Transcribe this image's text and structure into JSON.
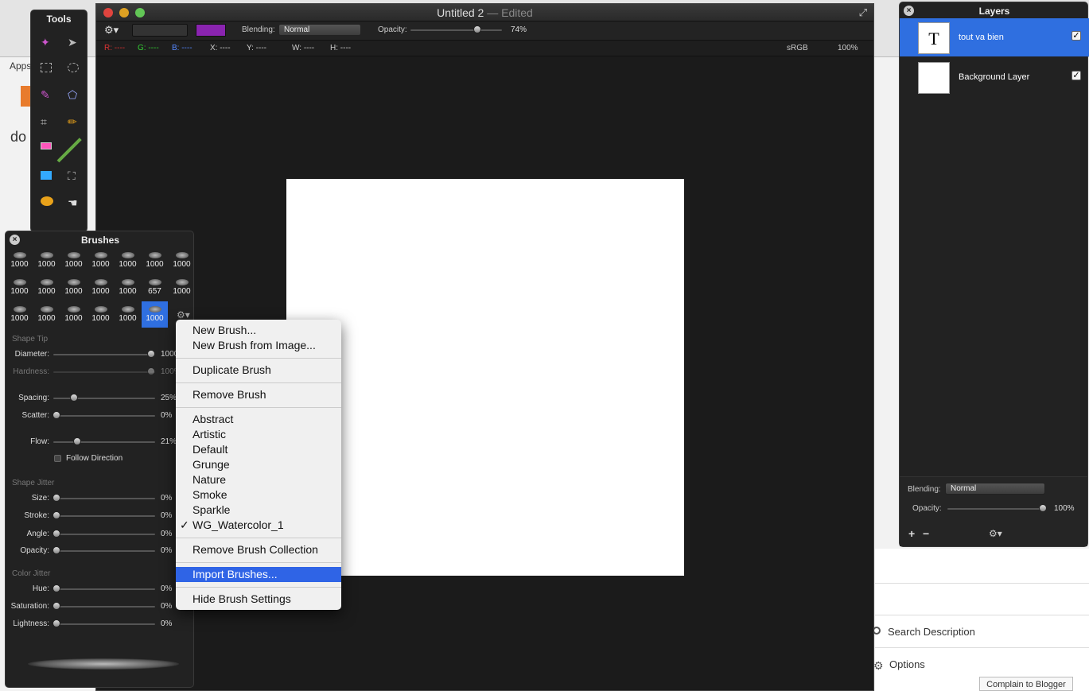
{
  "main_window": {
    "title": "Untitled 2",
    "edited": "— Edited",
    "blending_label": "Blending:",
    "blending_value": "Normal",
    "opacity_label": "Opacity:",
    "opacity_value": "74%",
    "opacity_level": 0.74,
    "color_swatch": "#8a24b0",
    "info": {
      "r": "R: ----",
      "g": "G: ----",
      "b": "B: ----",
      "x": "X: ----",
      "y": "Y: ----",
      "w": "W: ----",
      "h": "H: ----",
      "profile": "sRGB",
      "zoom": "100%"
    }
  },
  "tools_panel": {
    "title": "Tools"
  },
  "brushes_panel": {
    "title": "Brushes",
    "brush_counts": [
      "1000",
      "1000",
      "1000",
      "1000",
      "1000",
      "1000",
      "1000",
      "1000",
      "1000",
      "1000",
      "1000",
      "1000",
      "657",
      "1000",
      "1000",
      "1000",
      "1000",
      "1000",
      "1000",
      "1000"
    ],
    "selected_index": 19,
    "shape_tip": "Shape Tip",
    "diameter_label": "Diameter:",
    "diameter_value": "1000",
    "hardness_label": "Hardness:",
    "hardness_value": "100%",
    "spacing_label": "Spacing:",
    "spacing_value": "25%",
    "scatter_label": "Scatter:",
    "scatter_value": "0%",
    "flow_label": "Flow:",
    "flow_value": "21%",
    "follow_direction": "Follow Direction",
    "shape_jitter": "Shape Jitter",
    "size_label": "Size:",
    "stroke_label": "Stroke:",
    "angle_label": "Angle:",
    "opacity_label": "Opacity:",
    "jitter_value": "0%",
    "color_jitter": "Color Jitter",
    "hue_label": "Hue:",
    "saturation_label": "Saturation:",
    "lightness_label": "Lightness:"
  },
  "context_menu": {
    "items": [
      "New Brush...",
      "New Brush from Image...",
      "Duplicate Brush",
      "Remove Brush",
      "Abstract",
      "Artistic",
      "Default",
      "Grunge",
      "Nature",
      "Smoke",
      "Sparkle",
      "WG_Watercolor_1",
      "Remove Brush Collection",
      "Import Brushes...",
      "Hide Brush Settings"
    ],
    "checkmark": "✓",
    "highlighted": "Import Brushes..."
  },
  "layers_panel": {
    "title": "Layers",
    "layers": [
      {
        "name": "tout va bien",
        "thumb": "T"
      },
      {
        "name": "Background Layer",
        "thumb": ""
      }
    ],
    "blending_label": "Blending:",
    "blending_value": "Normal",
    "opacity_label": "Opacity:",
    "opacity_value": "100%",
    "add": "+",
    "remove": "−"
  },
  "browser_bg": {
    "apps": "Apps",
    "search_description": "Search Description",
    "options": "Options",
    "complain": "Complain to Blogger",
    "text_do": "do"
  }
}
